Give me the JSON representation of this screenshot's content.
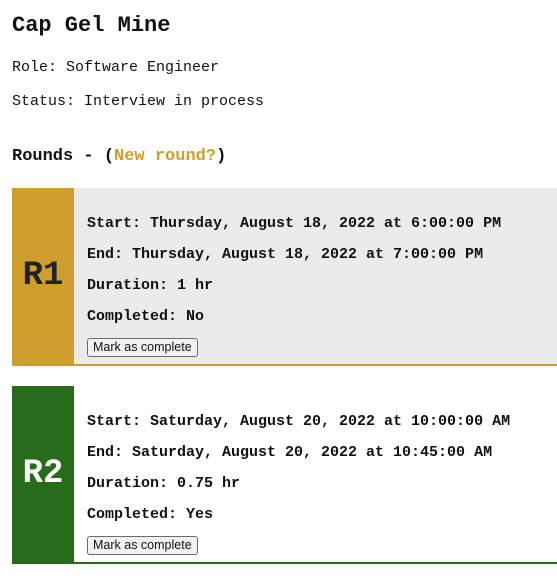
{
  "company": {
    "name": "Cap Gel Mine"
  },
  "role": "Role: Software Engineer",
  "status": "Status: Interview in process",
  "rounds_section": {
    "heading_prefix": "Rounds - (",
    "new_round_label": "New round?",
    "heading_suffix": ")"
  },
  "rounds": [
    {
      "badge": "R1",
      "color": "#cf9f2d",
      "start": "Start: Thursday, August 18, 2022 at 6:00:00 PM",
      "end": "End: Thursday, August 18, 2022 at 7:00:00 PM",
      "duration": "Duration: 1 hr",
      "completed": "Completed: No",
      "button_label": "Mark as complete"
    },
    {
      "badge": "R2",
      "color": "#286b1a",
      "start": "Start: Saturday, August 20, 2022 at 10:00:00 AM",
      "end": "End: Saturday, August 20, 2022 at 10:45:00 AM",
      "duration": "Duration: 0.75 hr",
      "completed": "Completed: Yes",
      "button_label": "Mark as complete"
    }
  ]
}
